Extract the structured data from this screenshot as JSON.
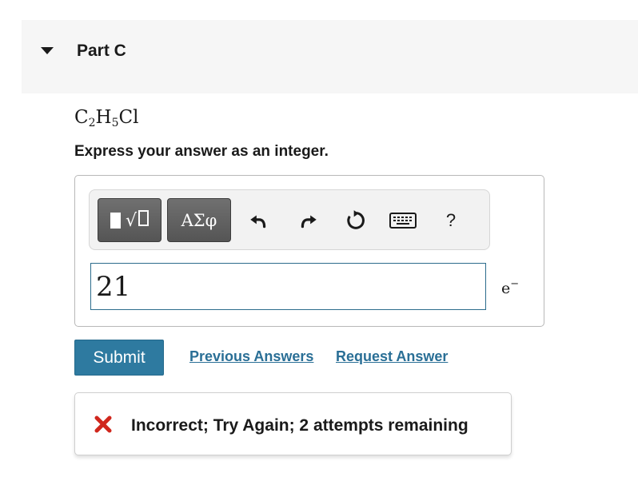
{
  "part": {
    "title": "Part C",
    "icon": "caret-down-icon"
  },
  "question": {
    "formula": {
      "c": "C",
      "c_sub": "2",
      "h": "H",
      "h_sub": "5",
      "cl": "Cl"
    },
    "instruction": "Express your answer as an integer."
  },
  "toolbar": {
    "template_button": "templates-icon",
    "greek_label": "ΑΣφ",
    "undo": "undo-icon",
    "redo": "redo-icon",
    "reset": "reset-icon",
    "keyboard": "keyboard-icon",
    "help_label": "?"
  },
  "answer": {
    "value": "21",
    "unit_base": "e",
    "unit_sup": "−"
  },
  "actions": {
    "submit_label": "Submit",
    "previous_answers_label": "Previous Answers",
    "request_answer_label": "Request Answer"
  },
  "feedback": {
    "status": "incorrect",
    "icon": "x-mark-icon",
    "message": "Incorrect; Try Again; 2 attempts remaining",
    "color": "#d0271d"
  },
  "colors": {
    "primary": "#2e7aa0",
    "link": "#2a6f96",
    "header_bg": "#f6f6f6"
  }
}
